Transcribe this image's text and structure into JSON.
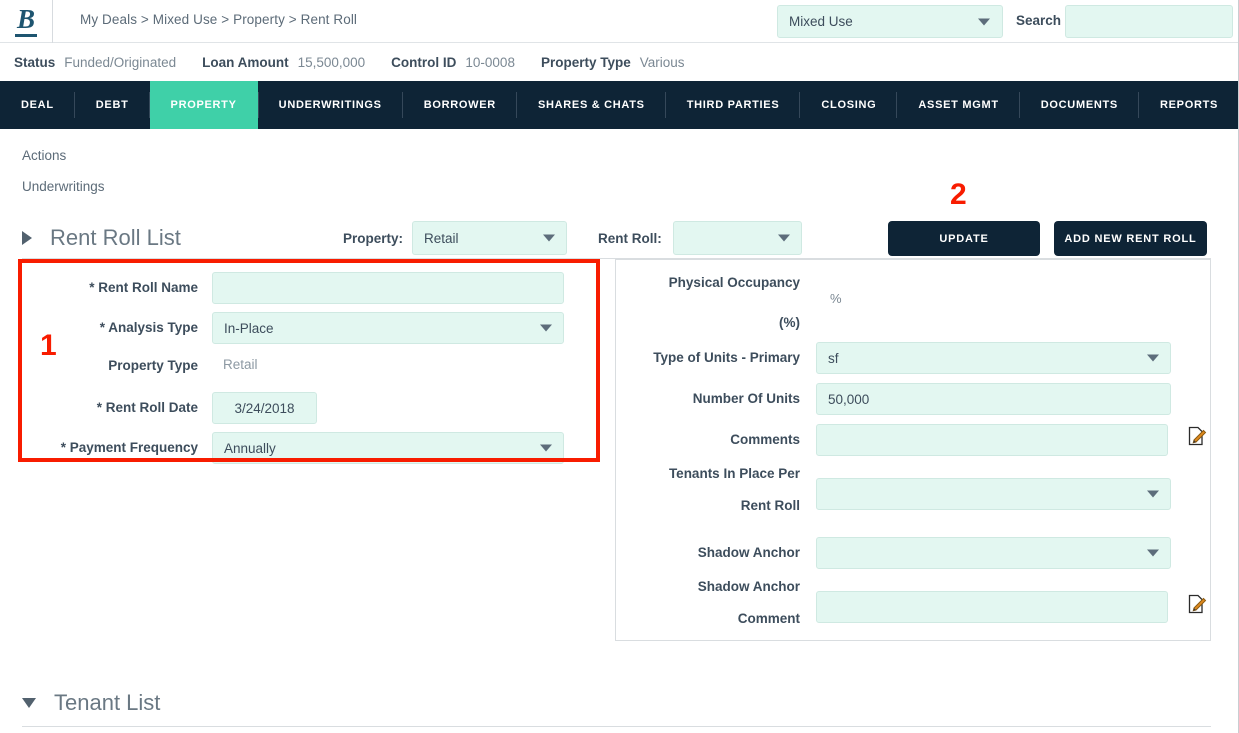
{
  "header": {
    "logo_text": "B",
    "breadcrumb": "My Deals > Mixed Use > Property > Rent Roll",
    "deal_select_value": "Mixed Use",
    "search_label": "Search",
    "search_value": "",
    "search_placeholder": ""
  },
  "status_strip": [
    {
      "key": "Status",
      "value": "Funded/Originated"
    },
    {
      "key": "Loan Amount",
      "value": "15,500,000"
    },
    {
      "key": "Control ID",
      "value": "10-0008"
    },
    {
      "key": "Property Type",
      "value": "Various"
    }
  ],
  "nav": {
    "tabs": [
      {
        "label": "DEAL",
        "active": false
      },
      {
        "label": "DEBT",
        "active": false
      },
      {
        "label": "PROPERTY",
        "active": true
      },
      {
        "label": "UNDERWRITINGS",
        "active": false
      },
      {
        "label": "BORROWER",
        "active": false
      },
      {
        "label": "SHARES & CHATS",
        "active": false
      },
      {
        "label": "THIRD PARTIES",
        "active": false
      },
      {
        "label": "CLOSING",
        "active": false
      },
      {
        "label": "ASSET MGMT",
        "active": false
      },
      {
        "label": "DOCUMENTS",
        "active": false
      },
      {
        "label": "REPORTS",
        "active": false
      }
    ]
  },
  "side_links": [
    {
      "label": "Actions"
    },
    {
      "label": "Underwritings"
    }
  ],
  "rent_roll_list": {
    "title": "Rent Roll List",
    "expand_icon": "triangle-right-icon",
    "property_label": "Property:",
    "property_value": "Retail",
    "rent_roll_label": "Rent Roll:",
    "rent_roll_value": "",
    "update_button": "UPDATE",
    "add_new_button": "ADD NEW RENT ROLL"
  },
  "form_left": {
    "rent_roll_name_label": "* Rent Roll Name",
    "rent_roll_name_value": "",
    "analysis_type_label": "* Analysis Type",
    "analysis_type_value": "In-Place",
    "property_type_label": "Property Type",
    "property_type_value": "Retail",
    "rent_roll_date_label": "* Rent Roll Date",
    "rent_roll_date_value": "3/24/2018",
    "payment_frequency_label": "* Payment Frequency",
    "payment_frequency_value": "Annually"
  },
  "form_right": {
    "physical_occupancy_label_line1": "Physical Occupancy",
    "physical_occupancy_label_line2": "(%)",
    "physical_occupancy_value": "",
    "percent_symbol": "%",
    "type_units_label": "Type of Units - Primary",
    "type_units_value": "sf",
    "number_units_label": "Number Of Units",
    "number_units_value": "50,000",
    "comments_label": "Comments",
    "comments_value": "",
    "tenants_label_line1": "Tenants In Place Per",
    "tenants_label_line2": "Rent Roll",
    "tenants_value": "",
    "shadow_anchor_label": "Shadow Anchor",
    "shadow_anchor_value": "",
    "shadow_comment_label_line1": "Shadow Anchor",
    "shadow_comment_label_line2": "Comment",
    "shadow_comment_value": "",
    "edit_icon_name": "edit-pencil-icon"
  },
  "tenant_list": {
    "title": "Tenant List",
    "collapse_icon": "triangle-down-icon"
  },
  "annotations": [
    {
      "number": "1",
      "target": "rent-roll-form-left"
    },
    {
      "number": "2",
      "target": "update-button"
    }
  ],
  "colors": {
    "nav_dark": "#0e2436",
    "accent_green": "#3fd0a8",
    "input_fill": "#e3f7f1",
    "annotation_red": "#f81c00",
    "logo_blue": "#1e5570"
  }
}
